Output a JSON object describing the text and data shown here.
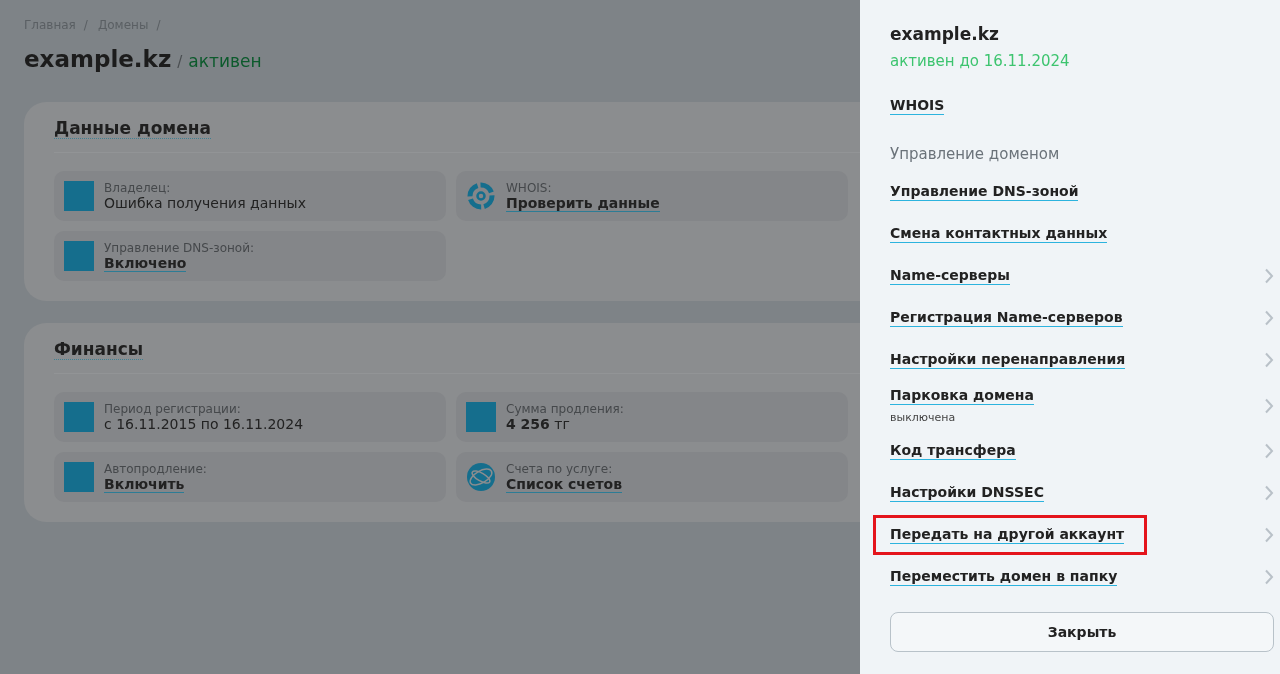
{
  "breadcrumbs": [
    {
      "label": "Главная",
      "separator": "/"
    },
    {
      "label": "Домены",
      "separator": "/"
    }
  ],
  "page_title": {
    "domain": "example.kz",
    "separator": "/",
    "status": "активен"
  },
  "cards": [
    {
      "title": "Данные домена",
      "tiles": [
        {
          "kind": "square",
          "label": "Владелец:",
          "value": "Ошибка получения данных",
          "link": false
        },
        {
          "kind": "whois",
          "label": "WHOIS:",
          "value": "Проверить данные",
          "link": true
        },
        {
          "kind": "square",
          "label": "Управление DNS-зоной:",
          "value": "Включено",
          "link": true
        }
      ]
    },
    {
      "title": "Финансы",
      "tiles": [
        {
          "kind": "square",
          "label": "Период регистрации:",
          "value": "с 16.11.2015 по 16.11.2024",
          "link": false
        },
        {
          "kind": "square",
          "label": "Сумма продления:",
          "value": "**4 256** тг",
          "link": false
        },
        {
          "kind": "square",
          "label": "Автопродление:",
          "value": "Включить",
          "link": true
        },
        {
          "kind": "globe",
          "label": "Счета по услуге:",
          "value": "Список счетов",
          "link": true
        }
      ]
    }
  ],
  "panel": {
    "domain": "example.kz",
    "status": "активен до 16.11.2024",
    "whois_link": "WHOIS",
    "section_title": "Управление доменом",
    "items": [
      {
        "label": "Управление DNS-зоной",
        "chevron": false,
        "highlighted": false
      },
      {
        "label": "Смена контактных данных",
        "chevron": false,
        "highlighted": false
      },
      {
        "label": "Name-серверы",
        "chevron": true,
        "highlighted": false
      },
      {
        "label": "Регистрация Name-серверов",
        "chevron": true,
        "highlighted": false
      },
      {
        "label": "Настройки перенаправления",
        "chevron": true,
        "highlighted": false
      },
      {
        "label": "Парковка домена",
        "note": "выключена",
        "chevron": true,
        "highlighted": false
      },
      {
        "label": "Код трансфера",
        "chevron": true,
        "highlighted": false
      },
      {
        "label": "Настройки DNSSEC",
        "chevron": true,
        "highlighted": false
      },
      {
        "label": "Передать на другой аккаунт",
        "chevron": true,
        "highlighted": true
      },
      {
        "label": "Переместить домен в папку",
        "chevron": true,
        "highlighted": false
      }
    ],
    "close_button": "Закрыть"
  }
}
